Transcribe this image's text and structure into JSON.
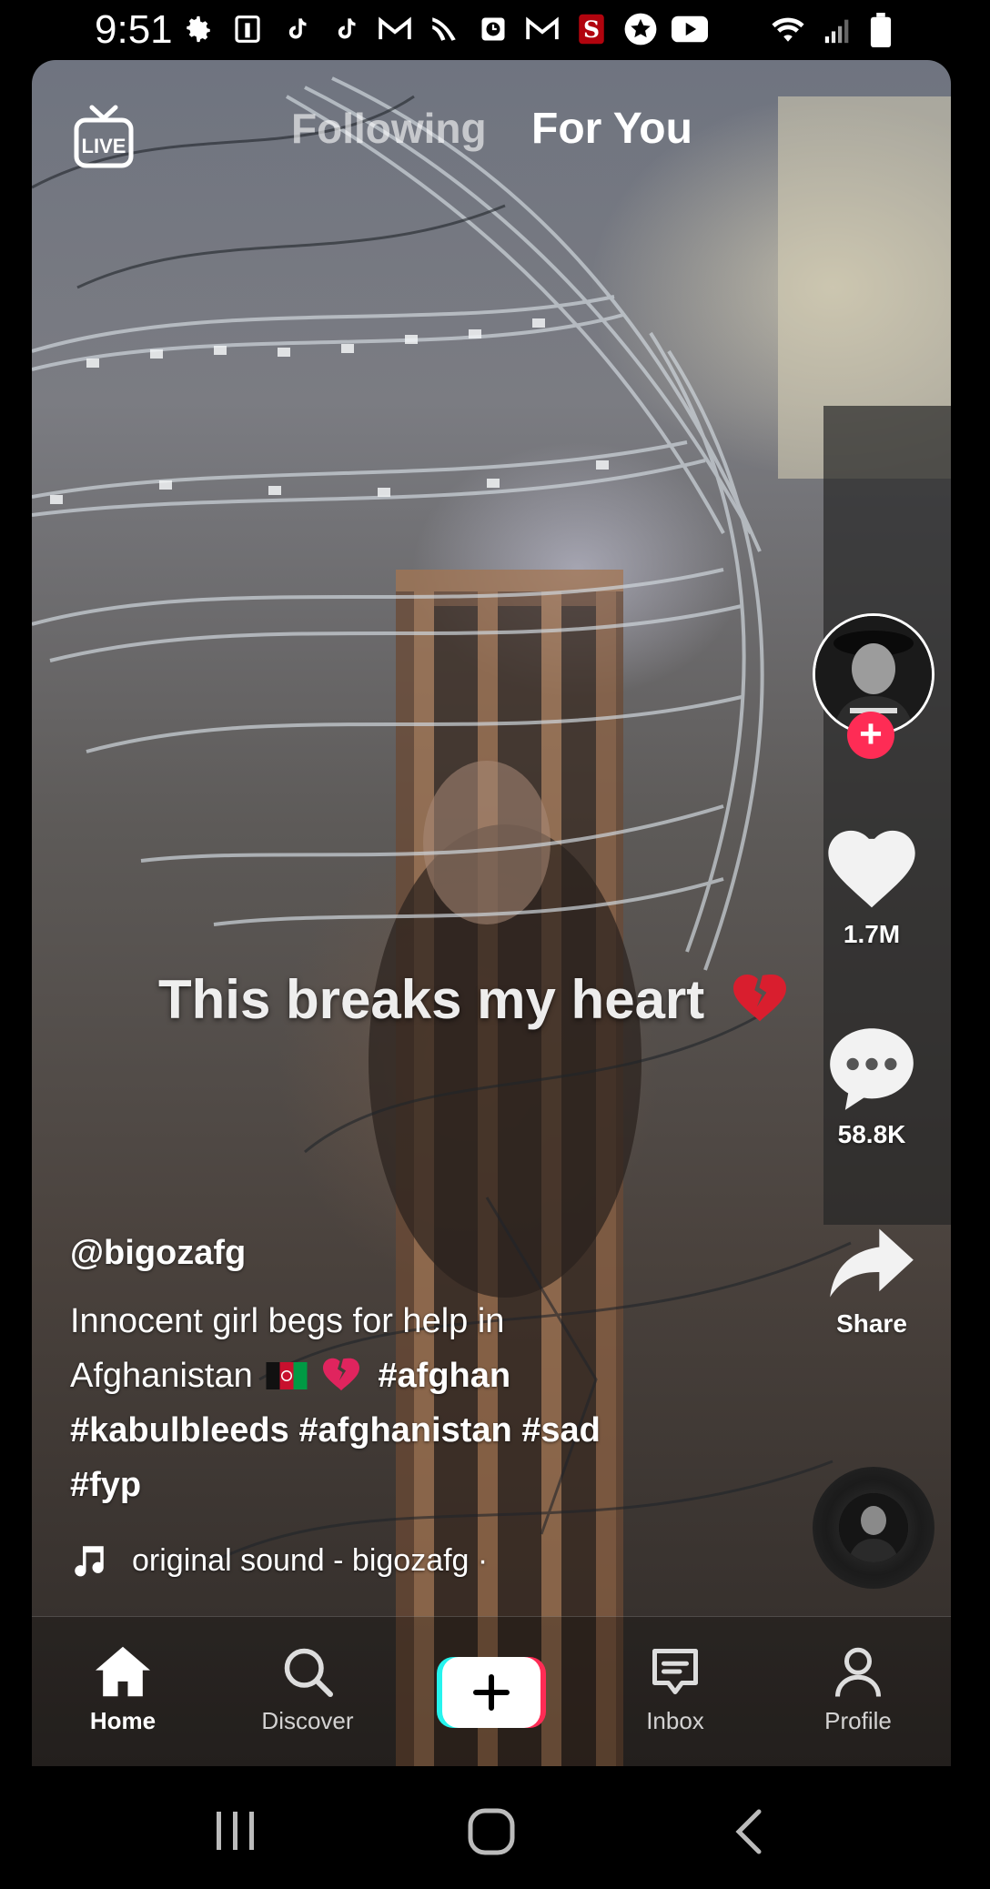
{
  "status_bar": {
    "time": "9:51",
    "icons": [
      "gear-icon",
      "instagram-icon",
      "tiktok-icon",
      "tiktok-icon",
      "gmail-icon",
      "sprint-icon",
      "clock-icon",
      "gmail-icon",
      "stanford-icon",
      "star-icon",
      "youtube-icon"
    ],
    "right_icons": [
      "wifi-icon",
      "signal-icon",
      "battery-icon"
    ]
  },
  "header": {
    "live_label": "LIVE",
    "tab_following": "Following",
    "tab_for_you": "For You",
    "active_tab": "For You"
  },
  "video": {
    "overlay_text": "This breaks my heart",
    "overlay_emoji": "broken-heart-icon"
  },
  "actions": {
    "likes": "1.7M",
    "comments": "58.8K",
    "share_label": "Share"
  },
  "post": {
    "username": "@bigozafg",
    "description_text": "Innocent girl begs for help in Afghanistan",
    "hashtags": [
      "#afghan",
      "#kabulbleeds",
      "#afghanistan",
      "#sad",
      "#fyp"
    ],
    "sound": "original sound - bigozafg ·"
  },
  "nav": {
    "home": "Home",
    "discover": "Discover",
    "inbox": "Inbox",
    "profile": "Profile",
    "active": "Home"
  },
  "colors": {
    "accent": "#fe2c55",
    "accent_cyan": "#25f4ee",
    "text": "#ffffff"
  }
}
